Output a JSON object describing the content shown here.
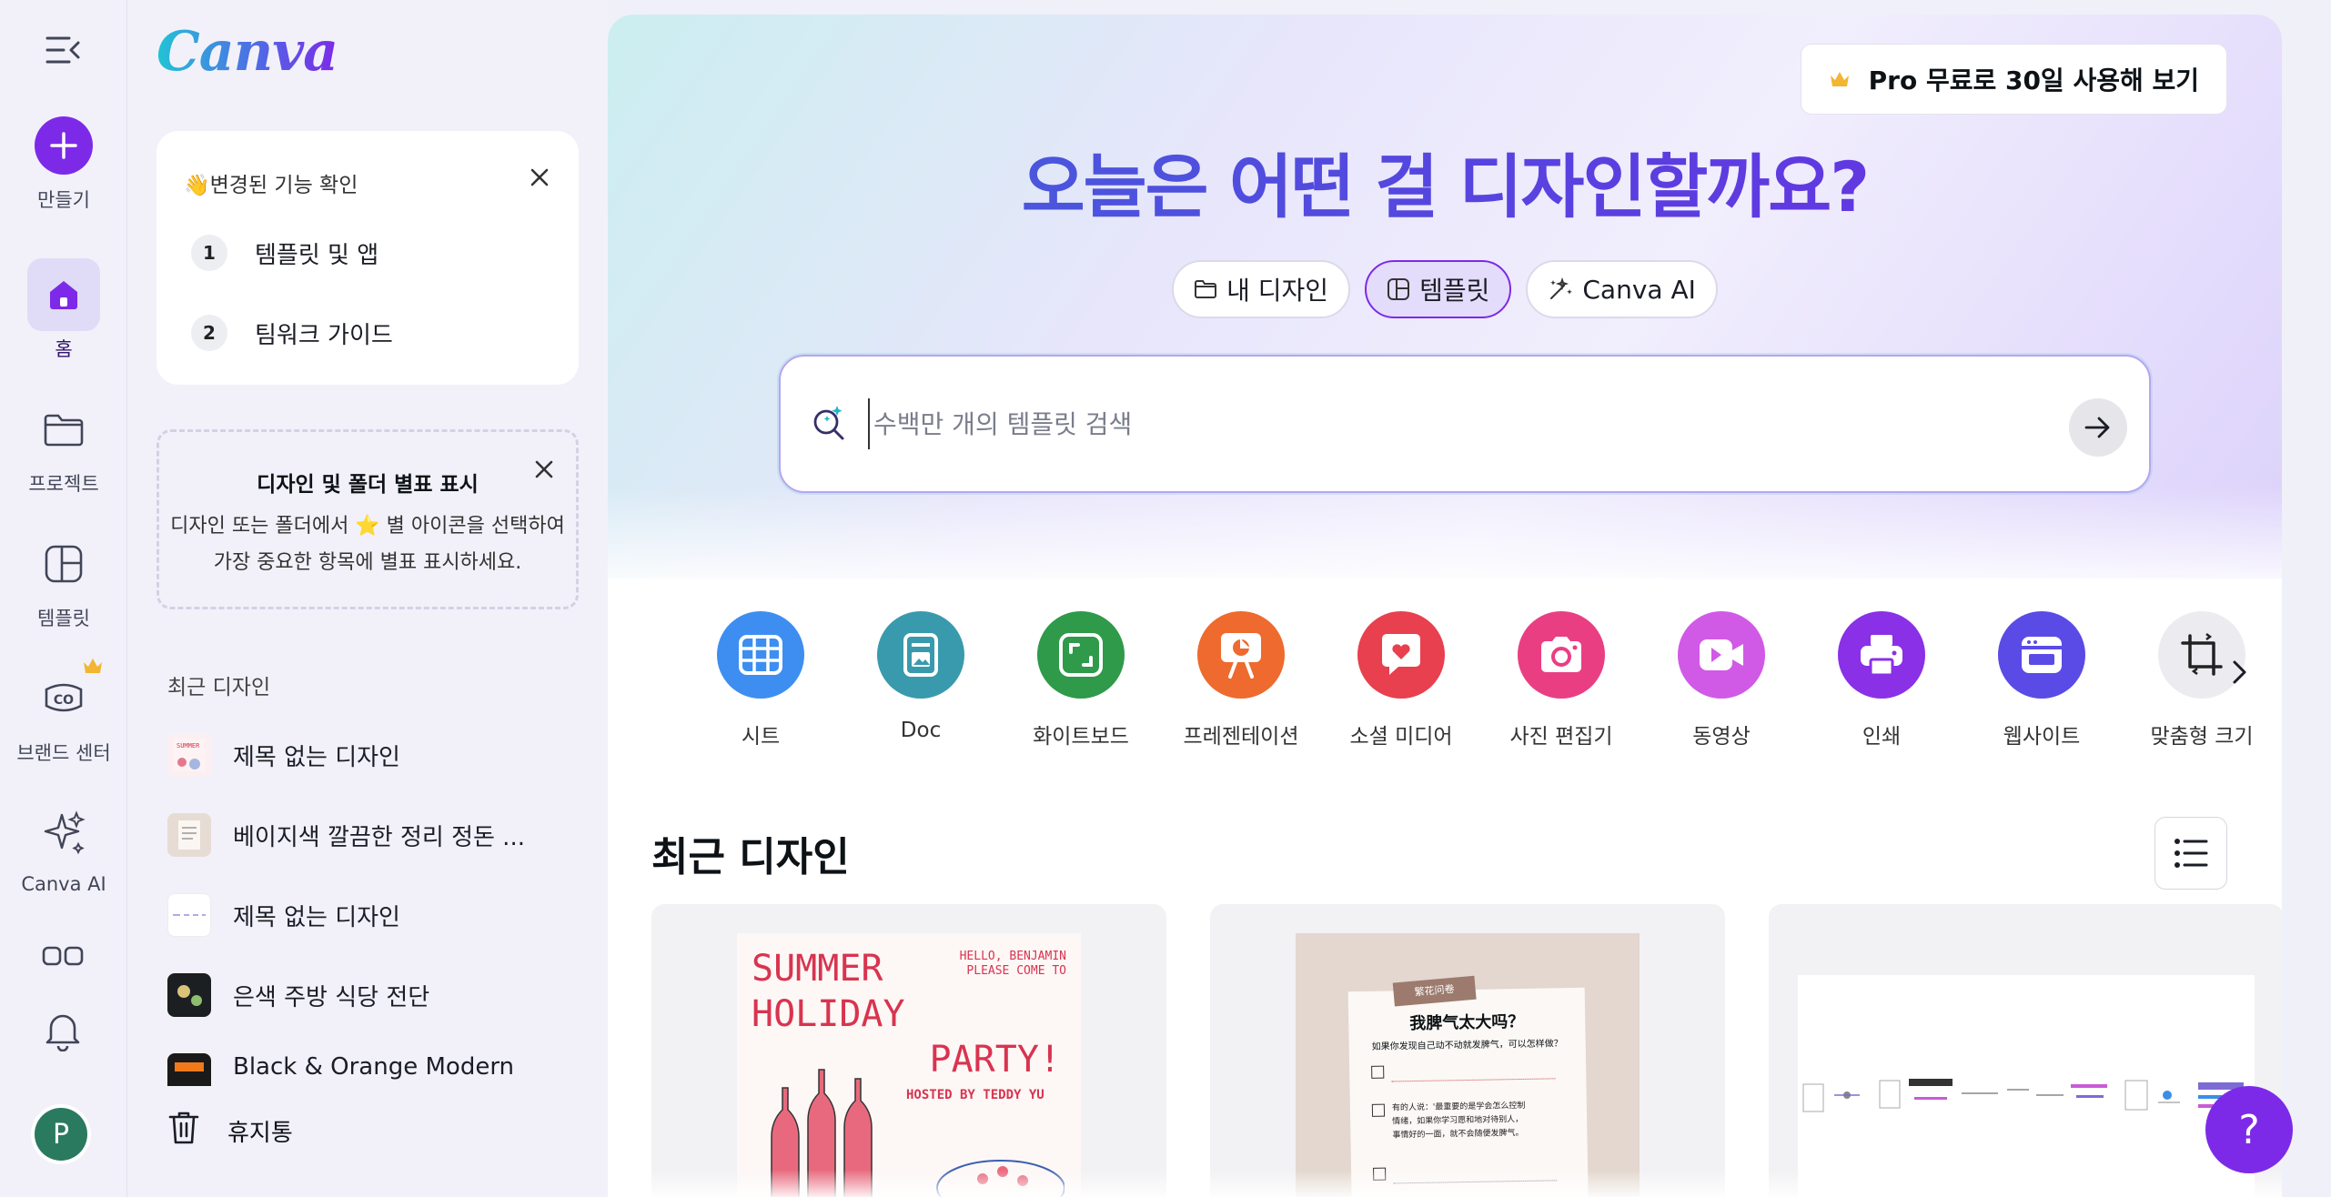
{
  "rail": {
    "create_label": "만들기",
    "items": [
      {
        "label": "홈",
        "icon": "home-icon"
      },
      {
        "label": "프로젝트",
        "icon": "folder-icon"
      },
      {
        "label": "템플릿",
        "icon": "template-icon"
      },
      {
        "label": "브랜드 센터",
        "icon": "brand-icon"
      },
      {
        "label": "Canva AI",
        "icon": "sparkle-icon"
      }
    ],
    "avatar_initial": "P"
  },
  "panel": {
    "logo": "Canva",
    "whats_new": {
      "title": "👋변경된 기능 확인",
      "steps": [
        {
          "num": "1",
          "label": "템플릿 및 앱"
        },
        {
          "num": "2",
          "label": "팀워크 가이드"
        }
      ]
    },
    "star_tip": {
      "title": "디자인 및 폴더 별표 표시",
      "line1": "디자인 또는 폴더에서 ⭐ 별 아이콘을 선택하여",
      "line2": "가장 중요한 항목에 별표 표시하세요."
    },
    "recent_heading": "최근 디자인",
    "recent": [
      "제목 없는 디자인",
      "베이지색 깔끔한 정리 정돈 ...",
      "제목 없는 디자인",
      "은색 주방 식당 전단",
      "Black & Orange Modern"
    ],
    "trash_label": "휴지통"
  },
  "main": {
    "pro_button": "Pro 무료로 30일 사용해 보기",
    "headline": "오늘은 어떤 걸 디자인할까요?",
    "tabs": [
      {
        "label": "내 디자인",
        "icon": "folder-icon"
      },
      {
        "label": "템플릿",
        "icon": "template-icon"
      },
      {
        "label": "Canva AI",
        "icon": "sparkle-icon"
      }
    ],
    "search_placeholder": "수백만 개의 템플릿 검색",
    "categories": [
      {
        "label": "시트",
        "color": "#3d8ef0"
      },
      {
        "label": "Doc",
        "color": "#3a9aad"
      },
      {
        "label": "화이트보드",
        "color": "#2e9a4a"
      },
      {
        "label": "프레젠테이션",
        "color": "#ee6a2e"
      },
      {
        "label": "소셜 미디어",
        "color": "#e8404e"
      },
      {
        "label": "사진 편집기",
        "color": "#ea3e83"
      },
      {
        "label": "동영상",
        "color": "#d05ae6"
      },
      {
        "label": "인쇄",
        "color": "#8a30e6"
      },
      {
        "label": "웹사이트",
        "color": "#5a4be6"
      },
      {
        "label": "맞춤형 크기",
        "color": "#ececf0"
      }
    ],
    "recent_title": "최근 디자인",
    "cards": {
      "summer": {
        "title_l1": "SUMMER",
        "title_l2": "HOLIDAY",
        "title_l3": "PARTY!",
        "note_l1": "HELLO, BENJAMIN",
        "note_l2": "PLEASE COME TO",
        "host": "HOSTED BY TEDDY YU"
      },
      "note": {
        "tag": "繁花问卷",
        "heading": "我脾气太大吗？",
        "sub": "如果你发现自己动不动就发脾气，可以怎样做？",
        "line1": "有的人说：'最重要的是学会怎么控制",
        "line2": "情绪，如果你学习愿和地对待别人，",
        "line3": "事情好的一面，就不会随便发脾气。"
      }
    },
    "help": "?"
  }
}
